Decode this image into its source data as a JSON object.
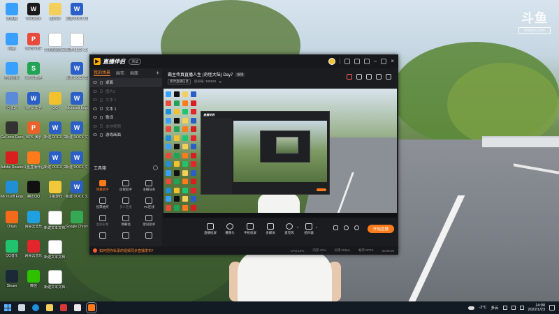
{
  "desktop": {
    "icons": [
      {
        "label": "此电脑",
        "color": "#3aa0ff",
        "glyph": ""
      },
      {
        "label": "WeGame",
        "color": "#1a1a1a",
        "glyph": "W"
      },
      {
        "label": "games",
        "color": "#f5cf5b",
        "glyph": ""
      },
      {
        "label": "新建 DOCX 文档.docx",
        "color": "#2b5fc7",
        "glyph": "W"
      },
      {
        "label": "网络",
        "color": "#3aa0ff",
        "glyph": ""
      },
      {
        "label": "WPS PDF",
        "color": "#e84b3c",
        "glyph": "P"
      },
      {
        "label": "1 (无标题).docx",
        "color": "#ffffff",
        "glyph": ""
      },
      {
        "label": "新建 XLSX 工作表.xlsx",
        "color": "#ffffff",
        "glyph": ""
      },
      {
        "label": "控制面板",
        "color": "#3aa0ff",
        "glyph": ""
      },
      {
        "label": "WPS 表格",
        "color": "#22a355",
        "glyph": "S"
      },
      {
        "label": "",
        "color": "transparent",
        "glyph": ""
      },
      {
        "label": "新建 DOCX 文档 (2).docx",
        "color": "#2b5fc7",
        "glyph": "W"
      },
      {
        "label": "回收站",
        "color": "#5a8ad8",
        "glyph": ""
      },
      {
        "label": "WPS 文字",
        "color": "#2b5fc7",
        "glyph": "W"
      },
      {
        "label": "QQ",
        "color": "#f2c12e",
        "glyph": ""
      },
      {
        "label": "Microsoft Edge.docx",
        "color": "#2b5fc7",
        "glyph": "W"
      },
      {
        "label": "GeForce Experience",
        "color": "#333333",
        "glyph": ""
      },
      {
        "label": "WPS 演示",
        "color": "#e8632b",
        "glyph": "P"
      },
      {
        "label": "新建 DOCX 文档 (3).docx",
        "color": "#2b5fc7",
        "glyph": "W"
      },
      {
        "label": "新建 DOCX 文档 (4).docx",
        "color": "#2b5fc7",
        "glyph": "W"
      },
      {
        "label": "Adobe Reader XI",
        "color": "#d81e1e",
        "glyph": ""
      },
      {
        "label": "斗鱼直播伴侣",
        "color": "#ff7a1a",
        "glyph": ""
      },
      {
        "label": "新建 DOCX 文档 (5).docx",
        "color": "#2b5fc7",
        "glyph": "W"
      },
      {
        "label": "新建 DOCX 文档 (6).docx",
        "color": "#2b5fc7",
        "glyph": "W"
      },
      {
        "label": "Microsoft Edge",
        "color": "#1f8fd6",
        "glyph": ""
      },
      {
        "label": "腾讯QQ",
        "color": "#111111",
        "glyph": ""
      },
      {
        "label": "斗鱼游戏",
        "color": "#f0c83a",
        "glyph": ""
      },
      {
        "label": "新建 DOCX 文档 (7).docx",
        "color": "#2b5fc7",
        "glyph": "W"
      },
      {
        "label": "Origin",
        "color": "#f46a1b",
        "glyph": ""
      },
      {
        "label": "网易云音乐",
        "color": "#20a0e0",
        "glyph": ""
      },
      {
        "label": "新建文本文档.txt",
        "color": "#ffffff",
        "glyph": ""
      },
      {
        "label": "Google Chrome",
        "color": "#34a853",
        "glyph": ""
      },
      {
        "label": "QQ音乐",
        "color": "#21c36e",
        "glyph": ""
      },
      {
        "label": "网易云音乐",
        "color": "#e3262c",
        "glyph": ""
      },
      {
        "label": "新建文本文档 (2).txt",
        "color": "#ffffff",
        "glyph": ""
      },
      {
        "label": "",
        "color": "transparent",
        "glyph": ""
      },
      {
        "label": "Steam",
        "color": "#1b2838",
        "glyph": ""
      },
      {
        "label": "微信",
        "color": "#2dc100",
        "glyph": ""
      },
      {
        "label": "新建文本文档 (3).txt",
        "color": "#ffffff",
        "glyph": ""
      },
      {
        "label": "",
        "color": "transparent",
        "glyph": ""
      }
    ]
  },
  "watermark": {
    "big": "斗鱼",
    "small": "douyu.com"
  },
  "app": {
    "title": "直播伴侣",
    "version": "测试",
    "tabs": [
      "我的场景",
      "画布",
      "画面"
    ],
    "scenes": [
      {
        "label": "桌面",
        "visible": true,
        "active": true
      },
      {
        "label": "图片2",
        "visible": false,
        "active": false
      },
      {
        "label": "文本 1",
        "visible": false,
        "active": false
      },
      {
        "label": "文本 1",
        "visible": true,
        "active": false
      },
      {
        "label": "歌词",
        "visible": true,
        "active": false
      },
      {
        "label": "本地视频",
        "visible": false,
        "active": false
      },
      {
        "label": "游戏画面",
        "visible": true,
        "active": false
      }
    ],
    "toolbox_title": "工具箱",
    "tools": [
      {
        "label": "弹幕助手",
        "style": "orange"
      },
      {
        "label": "房管助手",
        "style": "normal"
      },
      {
        "label": "主播任务",
        "style": "normal"
      },
      {
        "label": "投票抽奖",
        "style": "normal"
      },
      {
        "label": "多人连麦",
        "style": "dim"
      },
      {
        "label": "PK连线",
        "style": "normal"
      },
      {
        "label": "虚拟形象",
        "style": "dim"
      },
      {
        "label": "弹幕墙",
        "style": "normal"
      },
      {
        "label": "歌词助手",
        "style": "normal"
      },
      {
        "label": "",
        "style": "normal"
      },
      {
        "label": "",
        "style": "normal"
      },
      {
        "label": "",
        "style": "normal"
      }
    ],
    "room_title": "霸主传真直播人生 (奇怪大陆) Day7",
    "room_tag": "编辑",
    "edit_label": "修改直播信息",
    "room_id": "房间号: 100193",
    "fans": "0",
    "controls": [
      {
        "label": "直播投屏"
      },
      {
        "label": "摄像头"
      },
      {
        "label": "手机投屏"
      },
      {
        "label": "多媒体"
      },
      {
        "label": "麦克风"
      },
      {
        "label": "扬声器"
      }
    ],
    "live_button": "开始直播",
    "status_warning": "如何把你私录的视频同步直播发布？",
    "status_items": [
      "CPU:10%",
      "内存:40%",
      "码率:0kbps",
      "帧率:0FPS",
      "00:00:00"
    ]
  },
  "taskbar": {
    "weather_temp": "-2°C",
    "weather_text": "多云",
    "time": "14:00",
    "date": "2022/1/23"
  }
}
